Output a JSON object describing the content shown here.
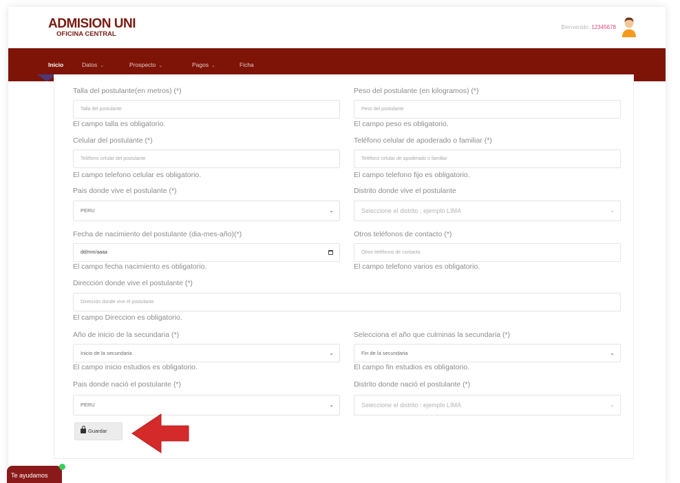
{
  "header": {
    "logo_title": "ADMISION UNI",
    "logo_subtitle": "OFICINA CENTRAL",
    "welcome_prefix": "Bienvenido,",
    "welcome_user": "12345678"
  },
  "nav": {
    "items": [
      {
        "label": "Inicio",
        "active": true
      },
      {
        "label": "Datos",
        "dropdown": true
      },
      {
        "label": "Prospecto",
        "dropdown": true
      },
      {
        "label": "Pagos",
        "dropdown": true
      },
      {
        "label": "Ficha"
      }
    ]
  },
  "form": {
    "talla": {
      "label": "Talla del postulante(en metros) (*)",
      "placeholder": "Talla del postulante",
      "error": "El campo talla es obligatorio."
    },
    "peso": {
      "label": "Peso del postulante (en kilogramos) (*)",
      "placeholder": "Peso del postulante",
      "error": "El campo peso es obligatorio."
    },
    "celular": {
      "label": "Celular del postulante (*)",
      "placeholder": "Teléfono celular del postulante",
      "error": "El campo telefono celular es obligatorio."
    },
    "telefono_apoderado": {
      "label": "Teléfono celular de apoderado o familiar (*)",
      "placeholder": "Teléfono celular de apoderado o familiar",
      "error": "El campo telefono fijo es obligatorio."
    },
    "pais_vive": {
      "label": "Pais donde vive el postulante (*)",
      "value": "PERU"
    },
    "distrito_vive": {
      "label": "Distrito donde vive el postulante",
      "placeholder": "Seleccione el distrito : ejemplo LIMA"
    },
    "fecha_nacimiento": {
      "label": "Fecha de nacimiento del postulante (dia-mes-año)(*)",
      "placeholder": "dd/mm/aaaa",
      "error": "El campo fecha nacimiento es obligatorio."
    },
    "otros_telefonos": {
      "label": "Otros teléfonos de contacto (*)",
      "placeholder": "Otros teléfonos de contacto",
      "error": "El campo telefono varios es obligatorio."
    },
    "direccion": {
      "label": "Dirección donde vive el postulante (*)",
      "placeholder": "Dirección donde vive el postulante",
      "error": "El campo Direccion es obligatorio."
    },
    "inicio_secundaria": {
      "label": "Año de inicio de la secundaria (*)",
      "value": "Inicio de la secundaria",
      "error": "El campo inicio estudios es obligatorio."
    },
    "fin_secundaria": {
      "label": "Selecciona el año que culminas la secundaria (*)",
      "value": "Fin de la secundaria",
      "error": "El campo fin estudios es obligatorio."
    },
    "pais_nacio": {
      "label": "Pais donde nació el postulante (*)",
      "value": "PERU"
    },
    "distrito_nacio": {
      "label": "Distrito donde nació el postulante (*)",
      "placeholder": "Seleccione el distrito : ejemplo LIMA"
    },
    "save_label": "Guardar"
  },
  "help_label": "Te ayudamos",
  "colors": {
    "brand": "#7d1407",
    "accent_red": "#d42a2a",
    "online": "#35d05a"
  }
}
